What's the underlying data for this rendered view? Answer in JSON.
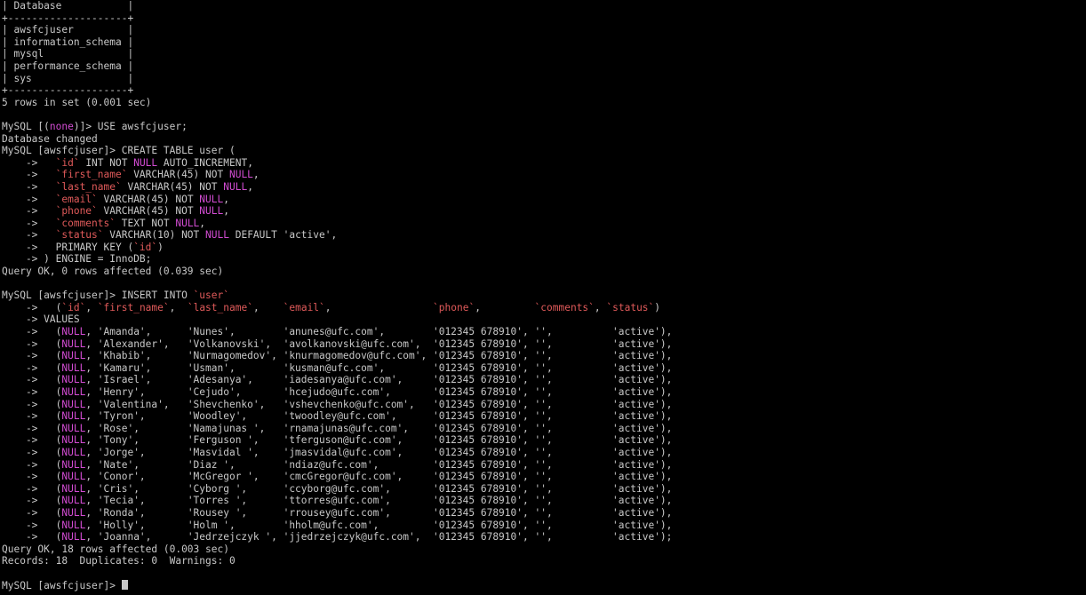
{
  "colors": {
    "background": "#000000",
    "default_text": "#c8c8c8",
    "keyword": "#d24cd2",
    "identifier": "#e05a5a"
  },
  "terminal": {
    "lines": [
      {
        "segments": [
          {
            "t": "| Database           |",
            "c": "default"
          }
        ]
      },
      {
        "segments": [
          {
            "t": "+--------------------+",
            "c": "default"
          }
        ]
      },
      {
        "segments": [
          {
            "t": "| awsfcjuser         |",
            "c": "default"
          }
        ]
      },
      {
        "segments": [
          {
            "t": "| information_schema |",
            "c": "default"
          }
        ]
      },
      {
        "segments": [
          {
            "t": "| mysql              |",
            "c": "default"
          }
        ]
      },
      {
        "segments": [
          {
            "t": "| performance_schema |",
            "c": "default"
          }
        ]
      },
      {
        "segments": [
          {
            "t": "| sys                |",
            "c": "default"
          }
        ]
      },
      {
        "segments": [
          {
            "t": "+--------------------+",
            "c": "default"
          }
        ]
      },
      {
        "segments": [
          {
            "t": "5 rows in set (0.001 sec)",
            "c": "default"
          }
        ]
      },
      {
        "segments": []
      },
      {
        "segments": [
          {
            "t": "MySQL [(",
            "c": "default"
          },
          {
            "t": "none",
            "c": "keyword"
          },
          {
            "t": ")]> USE awsfcjuser;",
            "c": "default"
          }
        ]
      },
      {
        "segments": [
          {
            "t": "Database changed",
            "c": "default"
          }
        ]
      },
      {
        "segments": [
          {
            "t": "MySQL [awsfcjuser]> CREATE TABLE user (",
            "c": "default"
          }
        ]
      },
      {
        "segments": [
          {
            "t": "    ->   ",
            "c": "default"
          },
          {
            "t": "`id`",
            "c": "ident"
          },
          {
            "t": " INT NOT ",
            "c": "default"
          },
          {
            "t": "NULL",
            "c": "keyword"
          },
          {
            "t": " AUTO_INCREMENT,",
            "c": "default"
          }
        ]
      },
      {
        "segments": [
          {
            "t": "    ->   ",
            "c": "default"
          },
          {
            "t": "`first_name`",
            "c": "ident"
          },
          {
            "t": " VARCHAR(45) NOT ",
            "c": "default"
          },
          {
            "t": "NULL",
            "c": "keyword"
          },
          {
            "t": ",",
            "c": "default"
          }
        ]
      },
      {
        "segments": [
          {
            "t": "    ->   ",
            "c": "default"
          },
          {
            "t": "`last_name`",
            "c": "ident"
          },
          {
            "t": " VARCHAR(45) NOT ",
            "c": "default"
          },
          {
            "t": "NULL",
            "c": "keyword"
          },
          {
            "t": ",",
            "c": "default"
          }
        ]
      },
      {
        "segments": [
          {
            "t": "    ->   ",
            "c": "default"
          },
          {
            "t": "`email`",
            "c": "ident"
          },
          {
            "t": " VARCHAR(45) NOT ",
            "c": "default"
          },
          {
            "t": "NULL",
            "c": "keyword"
          },
          {
            "t": ",",
            "c": "default"
          }
        ]
      },
      {
        "segments": [
          {
            "t": "    ->   ",
            "c": "default"
          },
          {
            "t": "`phone`",
            "c": "ident"
          },
          {
            "t": " VARCHAR(45) NOT ",
            "c": "default"
          },
          {
            "t": "NULL",
            "c": "keyword"
          },
          {
            "t": ",",
            "c": "default"
          }
        ]
      },
      {
        "segments": [
          {
            "t": "    ->   ",
            "c": "default"
          },
          {
            "t": "`comments`",
            "c": "ident"
          },
          {
            "t": " TEXT NOT ",
            "c": "default"
          },
          {
            "t": "NULL",
            "c": "keyword"
          },
          {
            "t": ",",
            "c": "default"
          }
        ]
      },
      {
        "segments": [
          {
            "t": "    ->   ",
            "c": "default"
          },
          {
            "t": "`status`",
            "c": "ident"
          },
          {
            "t": " VARCHAR(10) NOT ",
            "c": "default"
          },
          {
            "t": "NULL",
            "c": "keyword"
          },
          {
            "t": " DEFAULT 'active',",
            "c": "default"
          }
        ]
      },
      {
        "segments": [
          {
            "t": "    ->   PRIMARY KEY (",
            "c": "default"
          },
          {
            "t": "`id`",
            "c": "ident"
          },
          {
            "t": ")",
            "c": "default"
          }
        ]
      },
      {
        "segments": [
          {
            "t": "    -> ) ENGINE = InnoDB;",
            "c": "default"
          }
        ]
      },
      {
        "segments": [
          {
            "t": "Query OK, 0 rows affected (0.039 sec)",
            "c": "default"
          }
        ]
      },
      {
        "segments": []
      },
      {
        "segments": [
          {
            "t": "MySQL [awsfcjuser]> INSERT INTO ",
            "c": "default"
          },
          {
            "t": "`user`",
            "c": "ident"
          }
        ]
      },
      {
        "segments": [
          {
            "t": "    ->   (",
            "c": "default"
          },
          {
            "t": "`id`",
            "c": "ident"
          },
          {
            "t": ", ",
            "c": "default"
          },
          {
            "t": "`first_name`",
            "c": "ident"
          },
          {
            "t": ",  ",
            "c": "default"
          },
          {
            "t": "`last_name`",
            "c": "ident"
          },
          {
            "t": ",    ",
            "c": "default"
          },
          {
            "t": "`email`",
            "c": "ident"
          },
          {
            "t": ",                 ",
            "c": "default"
          },
          {
            "t": "`phone`",
            "c": "ident"
          },
          {
            "t": ",         ",
            "c": "default"
          },
          {
            "t": "`comments`",
            "c": "ident"
          },
          {
            "t": ", ",
            "c": "default"
          },
          {
            "t": "`status`",
            "c": "ident"
          },
          {
            "t": ")",
            "c": "default"
          }
        ]
      },
      {
        "segments": [
          {
            "t": "    -> VALUES",
            "c": "default"
          }
        ]
      },
      {
        "segments": [
          {
            "t": "    ->   (",
            "c": "default"
          },
          {
            "t": "NULL",
            "c": "keyword"
          },
          {
            "t": ", 'Amanda',      'Nunes',        'anunes@ufc.com',        '012345 678910', '',          'active'),",
            "c": "default"
          }
        ]
      },
      {
        "segments": [
          {
            "t": "    ->   (",
            "c": "default"
          },
          {
            "t": "NULL",
            "c": "keyword"
          },
          {
            "t": ", 'Alexander',   'Volkanovski',  'avolkanovski@ufc.com',  '012345 678910', '',          'active'),",
            "c": "default"
          }
        ]
      },
      {
        "segments": [
          {
            "t": "    ->   (",
            "c": "default"
          },
          {
            "t": "NULL",
            "c": "keyword"
          },
          {
            "t": ", 'Khabib',      'Nurmagomedov', 'knurmagomedov@ufc.com', '012345 678910', '',          'active'),",
            "c": "default"
          }
        ]
      },
      {
        "segments": [
          {
            "t": "    ->   (",
            "c": "default"
          },
          {
            "t": "NULL",
            "c": "keyword"
          },
          {
            "t": ", 'Kamaru',      'Usman',        'kusman@ufc.com',        '012345 678910', '',          'active'),",
            "c": "default"
          }
        ]
      },
      {
        "segments": [
          {
            "t": "    ->   (",
            "c": "default"
          },
          {
            "t": "NULL",
            "c": "keyword"
          },
          {
            "t": ", 'Israel',      'Adesanya',     'iadesanya@ufc.com',     '012345 678910', '',          'active'),",
            "c": "default"
          }
        ]
      },
      {
        "segments": [
          {
            "t": "    ->   (",
            "c": "default"
          },
          {
            "t": "NULL",
            "c": "keyword"
          },
          {
            "t": ", 'Henry',       'Cejudo',       'hcejudo@ufc.com',       '012345 678910', '',          'active'),",
            "c": "default"
          }
        ]
      },
      {
        "segments": [
          {
            "t": "    ->   (",
            "c": "default"
          },
          {
            "t": "NULL",
            "c": "keyword"
          },
          {
            "t": ", 'Valentina',   'Shevchenko',   'vshevchenko@ufc.com',   '012345 678910', '',          'active'),",
            "c": "default"
          }
        ]
      },
      {
        "segments": [
          {
            "t": "    ->   (",
            "c": "default"
          },
          {
            "t": "NULL",
            "c": "keyword"
          },
          {
            "t": ", 'Tyron',       'Woodley',      'twoodley@ufc.com',      '012345 678910', '',          'active'),",
            "c": "default"
          }
        ]
      },
      {
        "segments": [
          {
            "t": "    ->   (",
            "c": "default"
          },
          {
            "t": "NULL",
            "c": "keyword"
          },
          {
            "t": ", 'Rose',        'Namajunas ',   'rnamajunas@ufc.com',    '012345 678910', '',          'active'),",
            "c": "default"
          }
        ]
      },
      {
        "segments": [
          {
            "t": "    ->   (",
            "c": "default"
          },
          {
            "t": "NULL",
            "c": "keyword"
          },
          {
            "t": ", 'Tony',        'Ferguson ',    'tferguson@ufc.com',     '012345 678910', '',          'active'),",
            "c": "default"
          }
        ]
      },
      {
        "segments": [
          {
            "t": "    ->   (",
            "c": "default"
          },
          {
            "t": "NULL",
            "c": "keyword"
          },
          {
            "t": ", 'Jorge',       'Masvidal ',    'jmasvidal@ufc.com',     '012345 678910', '',          'active'),",
            "c": "default"
          }
        ]
      },
      {
        "segments": [
          {
            "t": "    ->   (",
            "c": "default"
          },
          {
            "t": "NULL",
            "c": "keyword"
          },
          {
            "t": ", 'Nate',        'Diaz ',        'ndiaz@ufc.com',         '012345 678910', '',          'active'),",
            "c": "default"
          }
        ]
      },
      {
        "segments": [
          {
            "t": "    ->   (",
            "c": "default"
          },
          {
            "t": "NULL",
            "c": "keyword"
          },
          {
            "t": ", 'Conor',       'McGregor ',    'cmcGregor@ufc.com',     '012345 678910', '',          'active'),",
            "c": "default"
          }
        ]
      },
      {
        "segments": [
          {
            "t": "    ->   (",
            "c": "default"
          },
          {
            "t": "NULL",
            "c": "keyword"
          },
          {
            "t": ", 'Cris',        'Cyborg ',      'ccyborg@ufc.com',       '012345 678910', '',          'active'),",
            "c": "default"
          }
        ]
      },
      {
        "segments": [
          {
            "t": "    ->   (",
            "c": "default"
          },
          {
            "t": "NULL",
            "c": "keyword"
          },
          {
            "t": ", 'Tecia',       'Torres ',      'ttorres@ufc.com',       '012345 678910', '',          'active'),",
            "c": "default"
          }
        ]
      },
      {
        "segments": [
          {
            "t": "    ->   (",
            "c": "default"
          },
          {
            "t": "NULL",
            "c": "keyword"
          },
          {
            "t": ", 'Ronda',       'Rousey ',      'rrousey@ufc.com',       '012345 678910', '',          'active'),",
            "c": "default"
          }
        ]
      },
      {
        "segments": [
          {
            "t": "    ->   (",
            "c": "default"
          },
          {
            "t": "NULL",
            "c": "keyword"
          },
          {
            "t": ", 'Holly',       'Holm ',        'hholm@ufc.com',         '012345 678910', '',          'active'),",
            "c": "default"
          }
        ]
      },
      {
        "segments": [
          {
            "t": "    ->   (",
            "c": "default"
          },
          {
            "t": "NULL",
            "c": "keyword"
          },
          {
            "t": ", 'Joanna',      'Jedrzejczyk ', 'jjedrzejczyk@ufc.com',  '012345 678910', '',          'active');",
            "c": "default"
          }
        ]
      },
      {
        "segments": [
          {
            "t": "Query OK, 18 rows affected (0.003 sec)",
            "c": "default"
          }
        ]
      },
      {
        "segments": [
          {
            "t": "Records: 18  Duplicates: 0  Warnings: 0",
            "c": "default"
          }
        ]
      },
      {
        "segments": []
      },
      {
        "segments": [
          {
            "t": "MySQL [awsfcjuser]> ",
            "c": "default"
          }
        ],
        "cursor": true
      }
    ]
  }
}
